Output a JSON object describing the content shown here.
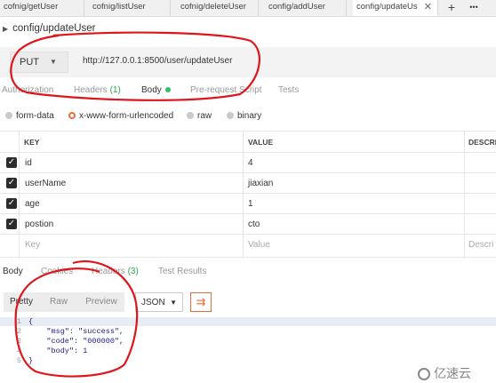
{
  "tabs": [
    {
      "label": "cofnig/getUser",
      "active": false
    },
    {
      "label": "cofnig/listUser",
      "active": false
    },
    {
      "label": "cofnig/deleteUser",
      "active": false
    },
    {
      "label": "config/addUser",
      "active": false
    },
    {
      "label": "config/updateUs",
      "active": true
    }
  ],
  "tab_actions": {
    "close": "✕",
    "add": "+",
    "more": "•••"
  },
  "request": {
    "title": "config/updateUser",
    "method": "PUT",
    "url": "http://127.0.0.1:8500/user/updateUser"
  },
  "request_tabs": [
    {
      "label": "Authorization"
    },
    {
      "label": "Headers",
      "count": "(1)"
    },
    {
      "label": "Body"
    },
    {
      "label": "Pre-request Script"
    },
    {
      "label": "Tests"
    }
  ],
  "body_types": [
    "form-data",
    "x-www-form-urlencoded",
    "raw",
    "binary"
  ],
  "selected_body_type": "x-www-form-urlencoded",
  "table": {
    "headers": {
      "key": "KEY",
      "value": "VALUE",
      "description": "DESCRI"
    },
    "rows": [
      {
        "key": "id",
        "value": "4",
        "checked": true
      },
      {
        "key": "userName",
        "value": "jiaxian",
        "checked": true
      },
      {
        "key": "age",
        "value": "1",
        "checked": true
      },
      {
        "key": "postion",
        "value": "cto",
        "checked": true
      }
    ],
    "placeholder": {
      "key": "Key",
      "value": "Value",
      "description": "Descri"
    }
  },
  "response_tabs": [
    {
      "label": "Body"
    },
    {
      "label": "Cookies"
    },
    {
      "label": "Headers",
      "count": "(3)"
    },
    {
      "label": "Test Results"
    }
  ],
  "format_buttons": [
    "Pretty",
    "Raw",
    "Preview"
  ],
  "format_select": "JSON",
  "code_lines": [
    {
      "num": "1",
      "text": "{"
    },
    {
      "num": "2",
      "text": "    \"msg\": \"success\","
    },
    {
      "num": "3",
      "text": "    \"code\": \"000000\","
    },
    {
      "num": "4",
      "text": "    \"body\": 1"
    },
    {
      "num": "5",
      "text": "}"
    }
  ],
  "watermark": "亿速云",
  "colors": {
    "accent": "#f26b3a",
    "status_dot": "#30c06a",
    "count_green": "#2ea44f",
    "annotation": "#e0141b"
  }
}
